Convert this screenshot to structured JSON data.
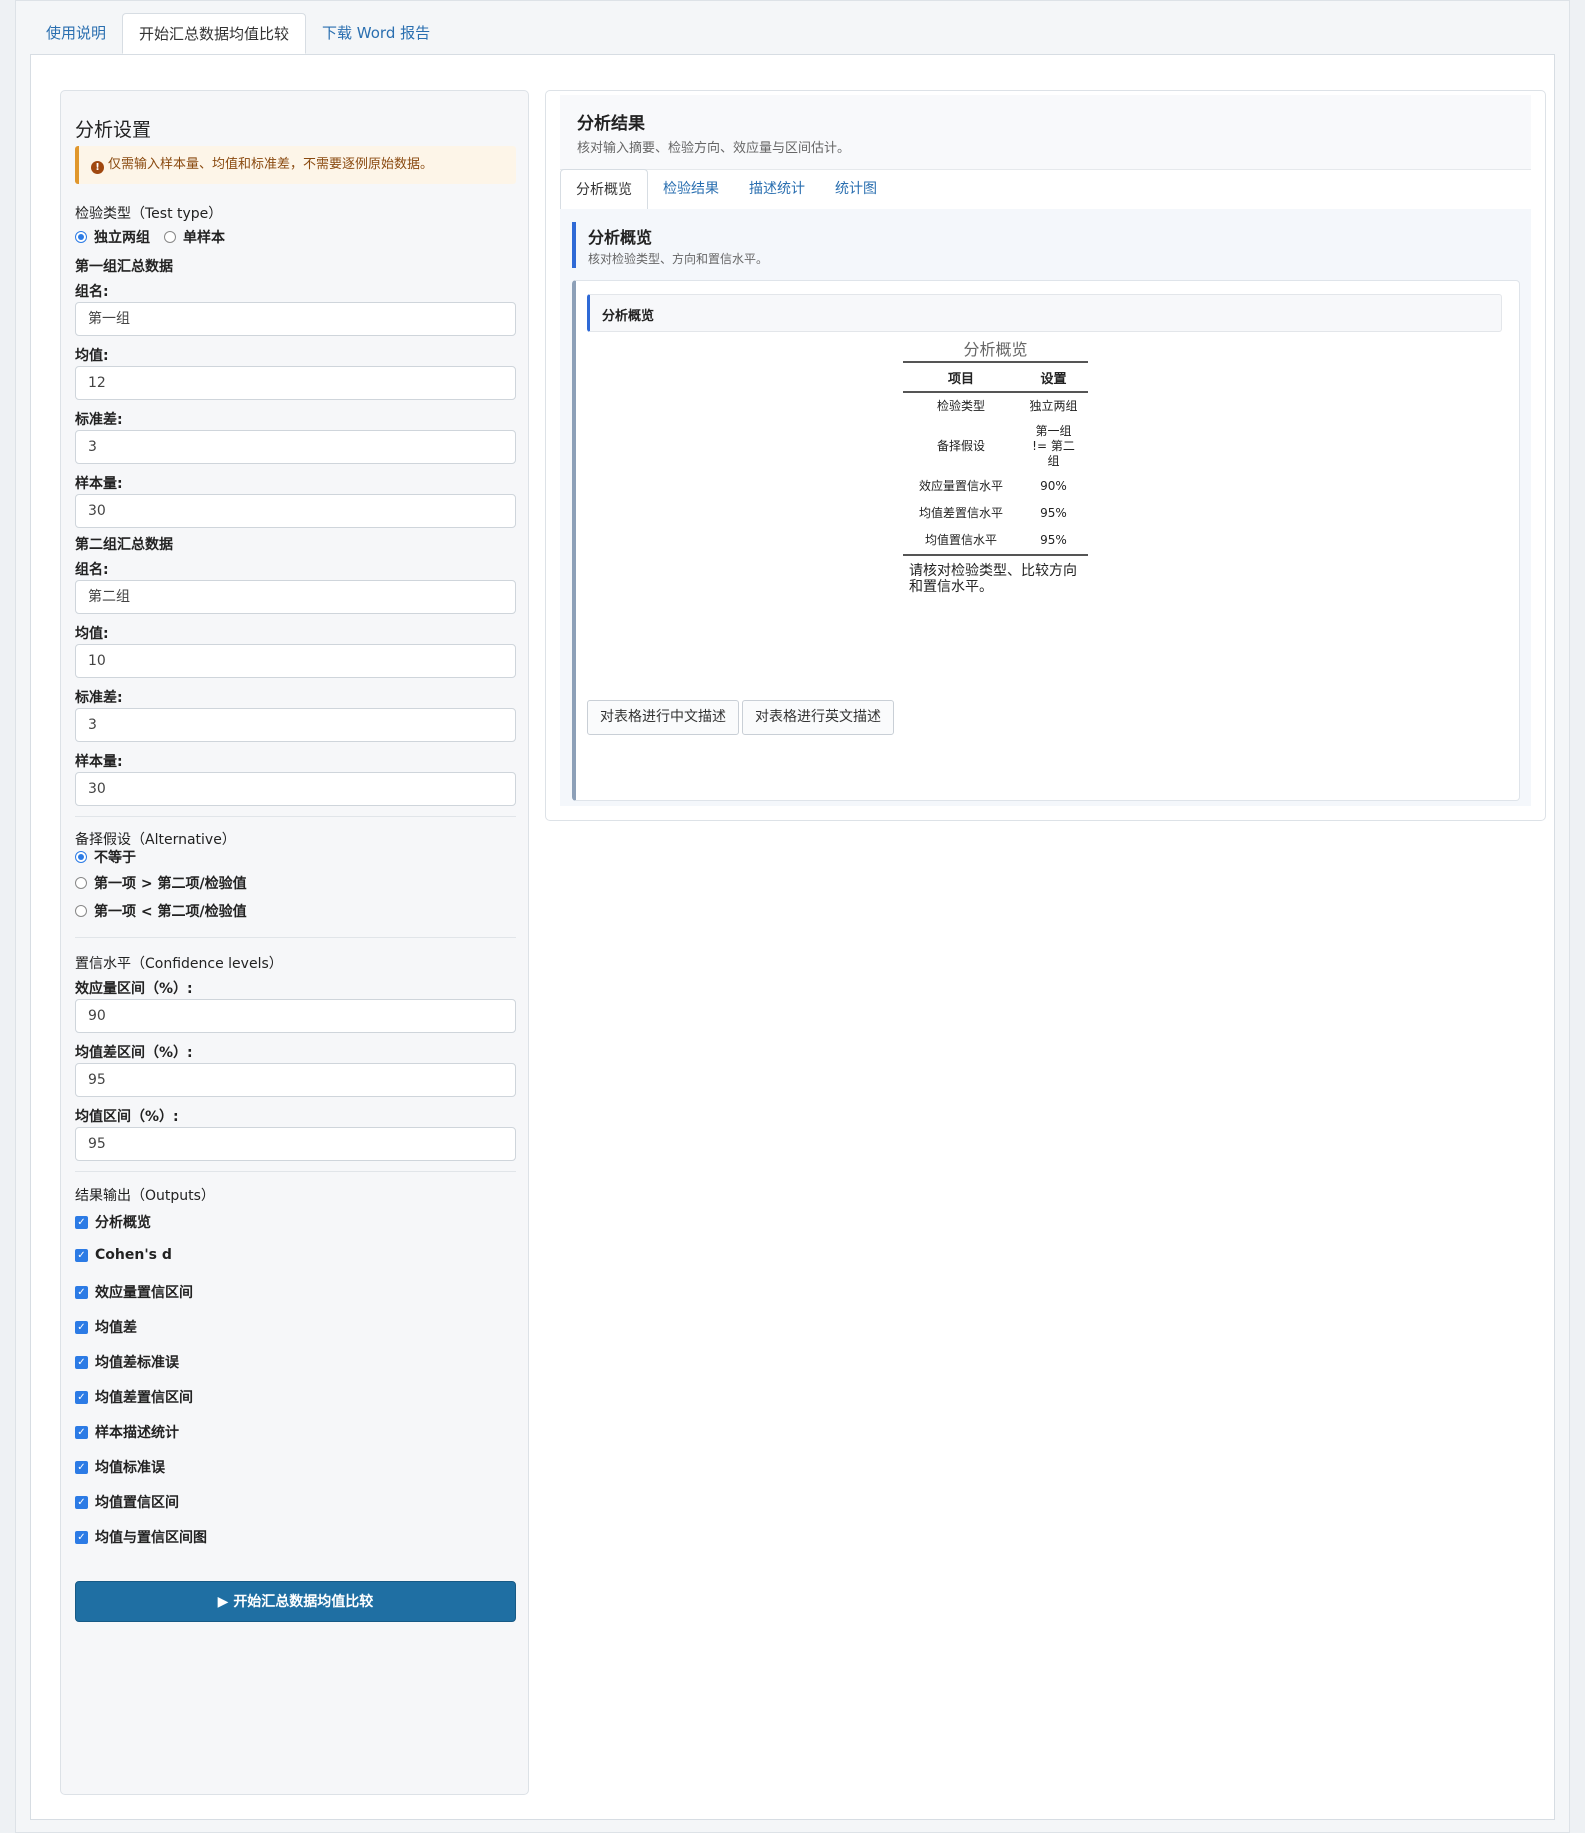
{
  "top_tabs": [
    {
      "label": "使用说明"
    },
    {
      "label": "开始汇总数据均值比较"
    },
    {
      "label": "下载 Word 报告"
    }
  ],
  "settings": {
    "title": "分析设置",
    "alert": "仅需输入样本量、均值和标准差，不需要逐例原始数据。",
    "test_type_label": "检验类型（Test type）",
    "test_type_options": [
      "独立两组",
      "单样本"
    ],
    "test_type_selected": "独立两组",
    "group1": {
      "heading": "第一组汇总数据",
      "name_label": "组名:",
      "name_value": "第一组",
      "mean_label": "均值:",
      "mean_value": "12",
      "sd_label": "标准差:",
      "sd_value": "3",
      "n_label": "样本量:",
      "n_value": "30"
    },
    "group2": {
      "heading": "第二组汇总数据",
      "name_label": "组名:",
      "name_value": "第二组",
      "mean_label": "均值:",
      "mean_value": "10",
      "sd_label": "标准差:",
      "sd_value": "3",
      "n_label": "样本量:",
      "n_value": "30"
    },
    "alternative_label": "备择假设（Alternative）",
    "alternative_options": [
      "不等于",
      "第一项 > 第二项/检验值",
      "第一项 < 第二项/检验值"
    ],
    "alternative_selected": "不等于",
    "confidence_label": "置信水平（Confidence levels）",
    "es_ci_label": "效应量区间（%）:",
    "es_ci_value": "90",
    "md_ci_label": "均值差区间（%）:",
    "md_ci_value": "95",
    "mean_ci_label": "均值区间（%）:",
    "mean_ci_value": "95",
    "outputs_label": "结果输出（Outputs）",
    "outputs": [
      "分析概览",
      "Cohen's d",
      "效应量置信区间",
      "均值差",
      "均值差标准误",
      "均值差置信区间",
      "样本描述统计",
      "均值标准误",
      "均值置信区间",
      "均值与置信区间图"
    ],
    "run_button": "▶ 开始汇总数据均值比较"
  },
  "results": {
    "title": "分析结果",
    "subtitle": "核对输入摘要、检验方向、效应量与区间估计。",
    "tabs": [
      "分析概览",
      "检验结果",
      "描述统计",
      "统计图"
    ],
    "section_title": "分析概览",
    "section_sub": "核对检验类型、方向和置信水平。",
    "card_title": "分析概览",
    "table": {
      "caption": "分析概览",
      "headers": [
        "项目",
        "设置"
      ],
      "rows": [
        [
          "检验类型",
          "独立两组"
        ],
        [
          "备择假设",
          "第一组 != 第二组"
        ],
        [
          "效应量置信水平",
          "90%"
        ],
        [
          "均值差置信水平",
          "95%"
        ],
        [
          "均值置信水平",
          "95%"
        ]
      ],
      "note": "请核对检验类型、比较方向和置信水平。"
    },
    "btn_cn": "对表格进行中文描述",
    "btn_en": "对表格进行英文描述"
  }
}
